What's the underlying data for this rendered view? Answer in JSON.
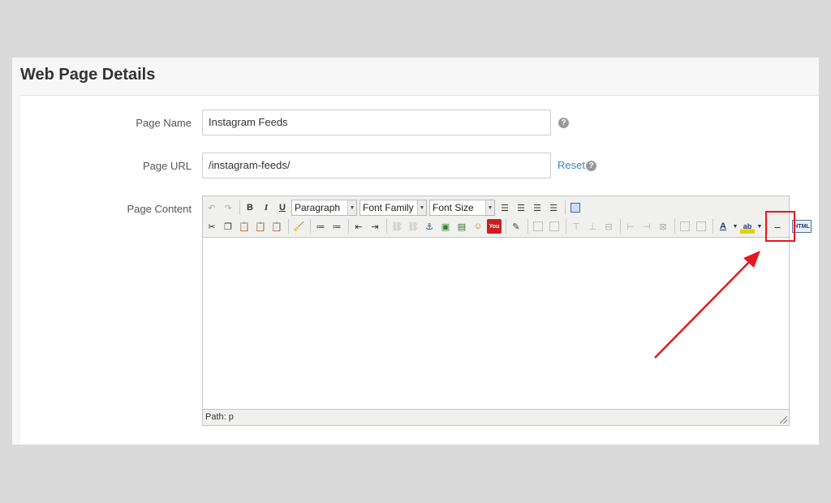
{
  "panel": {
    "title": "Web Page Details"
  },
  "fields": {
    "page_name": {
      "label": "Page Name",
      "value": "Instagram Feeds"
    },
    "page_url": {
      "label": "Page URL",
      "value": "/instagram-feeds/",
      "reset": "Reset"
    },
    "page_content": {
      "label": "Page Content"
    }
  },
  "help_glyph": "?",
  "editor": {
    "toolbar": {
      "bold": "B",
      "italic": "I",
      "underline": "U",
      "format_select": "Paragraph",
      "font_family_select": "Font Family",
      "font_size_select": "Font Size",
      "html_button": "HTML",
      "text_color": "A",
      "highlight": "ab",
      "youtube": "You"
    },
    "status_path": "Path: p"
  },
  "colors": {
    "annotation": "#e5191e",
    "link": "#3a7fc6"
  }
}
